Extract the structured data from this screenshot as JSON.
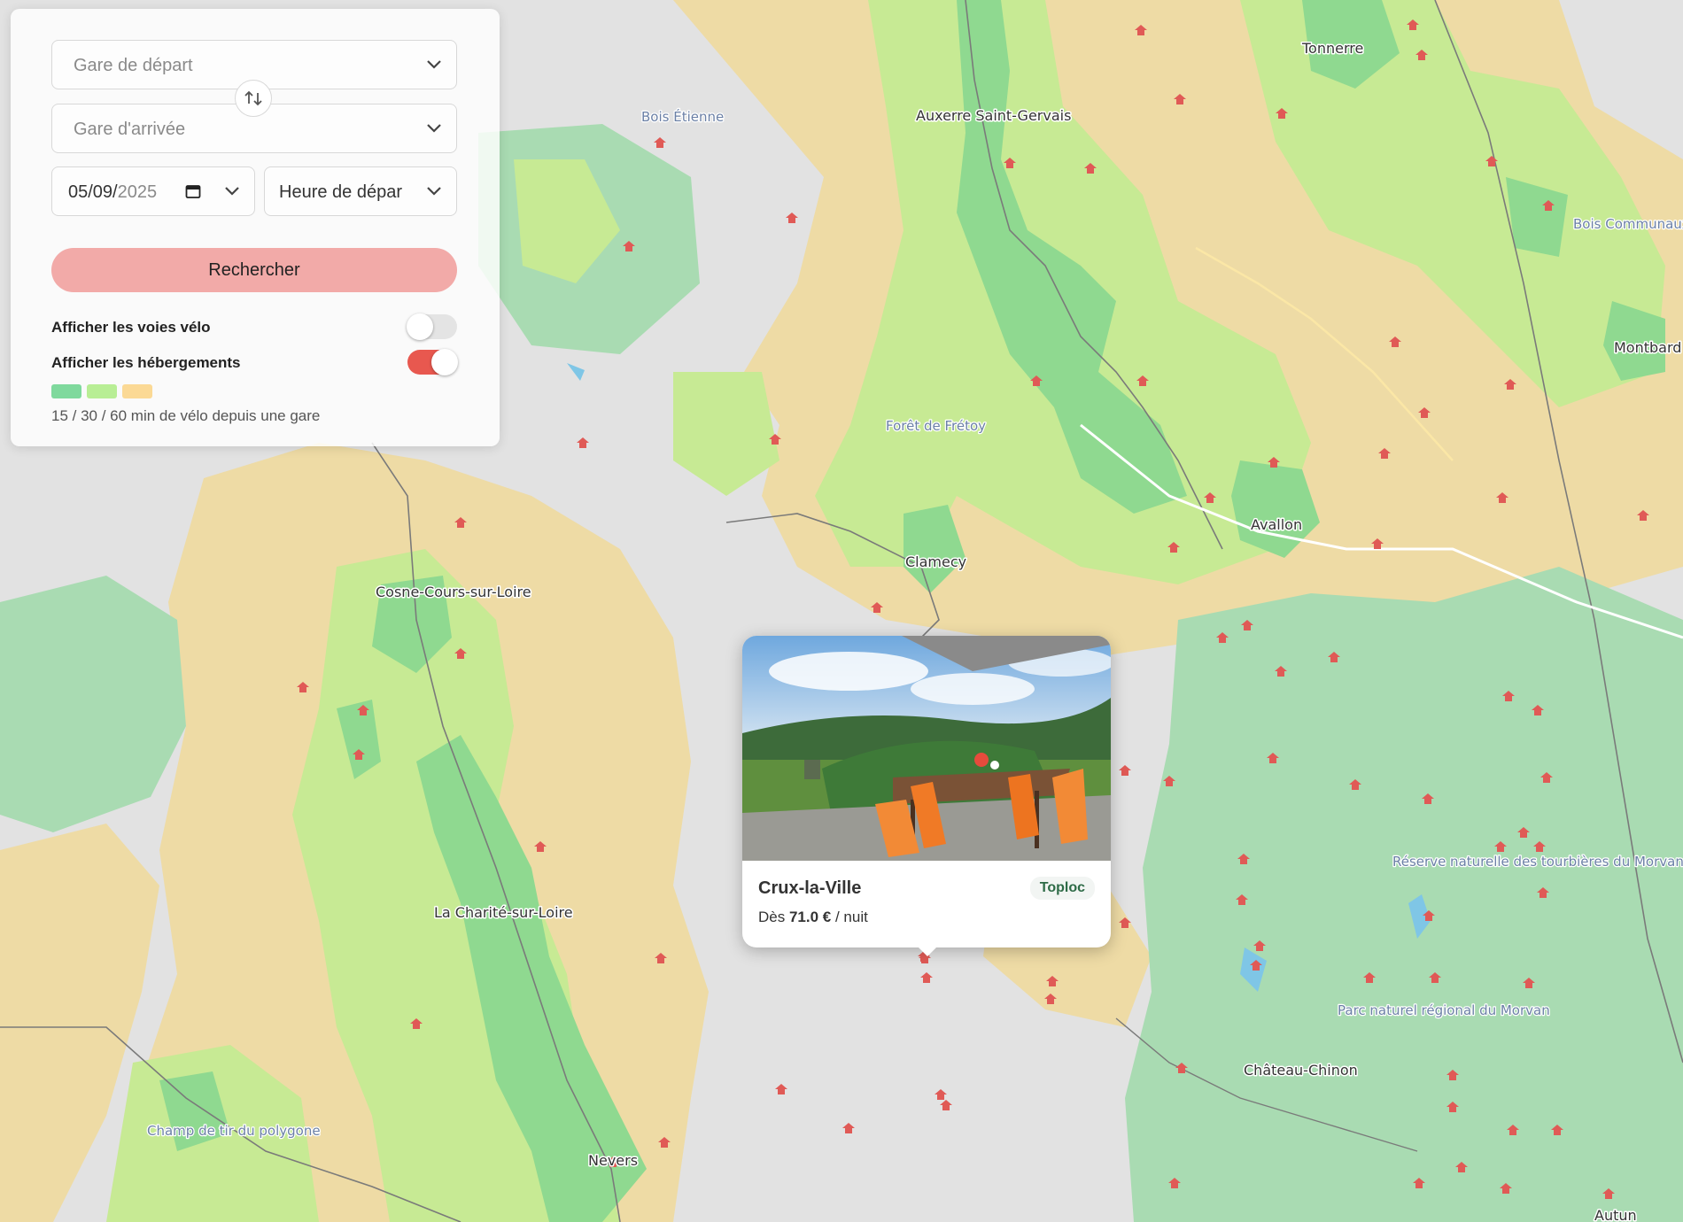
{
  "form": {
    "departure_placeholder": "Gare de départ",
    "arrival_placeholder": "Gare d'arrivée",
    "date_value": "05/09/",
    "date_year": "2025",
    "time_placeholder": "Heure de dépar",
    "search_label": "Rechercher"
  },
  "toggles": {
    "bike_label": "Afficher les voies vélo",
    "bike_on": false,
    "lodging_label": "Afficher les hébergements",
    "lodging_on": true
  },
  "legend": {
    "colors": [
      "#7fd99d",
      "#b8ee95",
      "#fbd995"
    ],
    "text": "15 / 30 / 60 min de vélo depuis une gare"
  },
  "colors": {
    "accent": "#e8584f",
    "search_button": "#f2aaa8",
    "zone_15": "#8ed98e",
    "zone_30": "#c7ea94",
    "zone_60": "#eedba5",
    "land": "#e2e2e2",
    "forest": "#a8dcb0"
  },
  "popup": {
    "title": "Crux-la-Ville",
    "provider": "Toploc",
    "price_prefix": "Dès",
    "price_value": "71.0 €",
    "price_suffix": "/ nuit"
  },
  "map": {
    "places": [
      "Tonnerre",
      "Auxerre Saint-Gervais",
      "Bois Étienne",
      "Bois Communaux de Ravières",
      "Montbard",
      "Forêt de Frétoy",
      "Avallon",
      "Clamecy",
      "Cosne-Cours-sur-Loire",
      "La Charité-sur-Loire",
      "Réserve naturelle des tourbières du Morvan",
      "Parc naturel régional du Morvan",
      "Château-Chinon",
      "Champ de tir du polygone",
      "Nevers",
      "Autun"
    ]
  }
}
